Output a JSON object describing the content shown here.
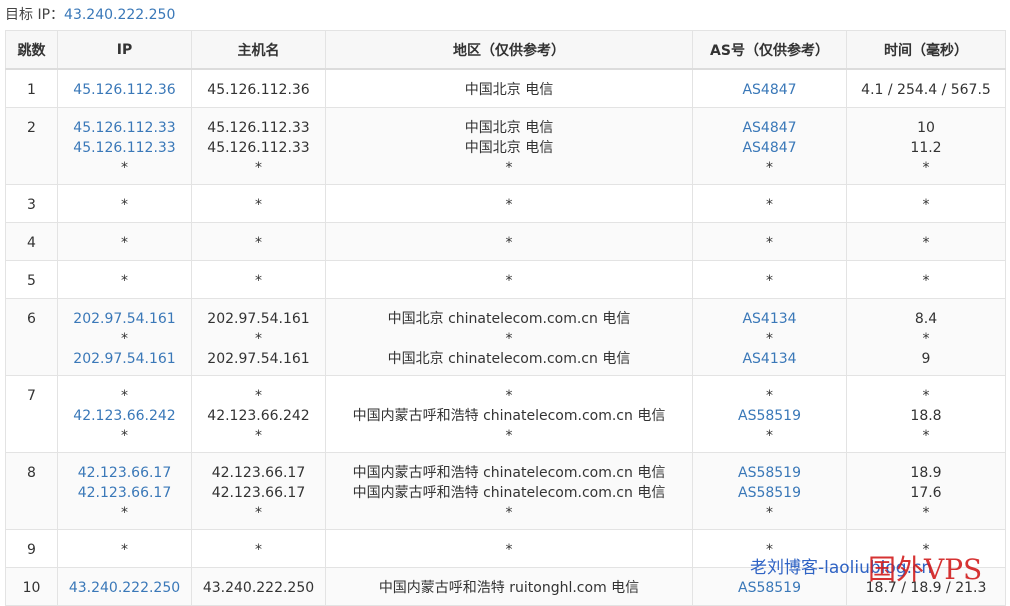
{
  "target": {
    "label": "目标 IP：",
    "ip": "43.240.222.250"
  },
  "headers": [
    "跳数",
    "IP",
    "主机名",
    "地区（仅供参考）",
    "AS号（仅供参考）",
    "时间（毫秒）"
  ],
  "rows": [
    {
      "hop": "1",
      "ip": [
        "45.126.112.36"
      ],
      "host": [
        "45.126.112.36"
      ],
      "region": [
        "中国北京 电信"
      ],
      "as": [
        "AS4847"
      ],
      "time": [
        "4.1 / 254.4 / 567.5"
      ]
    },
    {
      "hop": "2",
      "ip": [
        "45.126.112.33",
        "45.126.112.33",
        "*"
      ],
      "host": [
        "45.126.112.33",
        "45.126.112.33",
        "*"
      ],
      "region": [
        "中国北京 电信",
        "中国北京 电信",
        "*"
      ],
      "as": [
        "AS4847",
        "AS4847",
        "*"
      ],
      "time": [
        "10",
        "11.2",
        "*"
      ]
    },
    {
      "hop": "3",
      "ip": [
        "*"
      ],
      "host": [
        "*"
      ],
      "region": [
        "*"
      ],
      "as": [
        "*"
      ],
      "time": [
        "*"
      ]
    },
    {
      "hop": "4",
      "ip": [
        "*"
      ],
      "host": [
        "*"
      ],
      "region": [
        "*"
      ],
      "as": [
        "*"
      ],
      "time": [
        "*"
      ]
    },
    {
      "hop": "5",
      "ip": [
        "*"
      ],
      "host": [
        "*"
      ],
      "region": [
        "*"
      ],
      "as": [
        "*"
      ],
      "time": [
        "*"
      ]
    },
    {
      "hop": "6",
      "ip": [
        "202.97.54.161",
        "*",
        "202.97.54.161"
      ],
      "host": [
        "202.97.54.161",
        "*",
        "202.97.54.161"
      ],
      "region": [
        "中国北京 chinatelecom.com.cn 电信",
        "*",
        "中国北京 chinatelecom.com.cn 电信"
      ],
      "as": [
        "AS4134",
        "*",
        "AS4134"
      ],
      "time": [
        "8.4",
        "*",
        "9"
      ]
    },
    {
      "hop": "7",
      "ip": [
        "*",
        "42.123.66.242",
        "*"
      ],
      "host": [
        "*",
        "42.123.66.242",
        "*"
      ],
      "region": [
        "*",
        "中国内蒙古呼和浩特 chinatelecom.com.cn 电信",
        "*"
      ],
      "as": [
        "*",
        "AS58519",
        "*"
      ],
      "time": [
        "*",
        "18.8",
        "*"
      ]
    },
    {
      "hop": "8",
      "ip": [
        "42.123.66.17",
        "42.123.66.17",
        "*"
      ],
      "host": [
        "42.123.66.17",
        "42.123.66.17",
        "*"
      ],
      "region": [
        "中国内蒙古呼和浩特 chinatelecom.com.cn 电信",
        "中国内蒙古呼和浩特 chinatelecom.com.cn 电信",
        "*"
      ],
      "as": [
        "AS58519",
        "AS58519",
        "*"
      ],
      "time": [
        "18.9",
        "17.6",
        "*"
      ]
    },
    {
      "hop": "9",
      "ip": [
        "*"
      ],
      "host": [
        "*"
      ],
      "region": [
        "*"
      ],
      "as": [
        "*"
      ],
      "time": [
        "*"
      ]
    },
    {
      "hop": "10",
      "ip": [
        "43.240.222.250"
      ],
      "host": [
        "43.240.222.250"
      ],
      "region": [
        "中国内蒙古呼和浩特 ruitonghl.com 电信"
      ],
      "as": [
        "AS58519"
      ],
      "time": [
        "18.7 / 18.9 / 21.3"
      ]
    }
  ],
  "watermark": {
    "blog": "老刘博客-laoliublog.cn",
    "vps": "国外VPS"
  },
  "colors": {
    "link": "#3a78b8",
    "watermark_blog": "#2f63c4",
    "watermark_vps": "#d21d1d"
  }
}
